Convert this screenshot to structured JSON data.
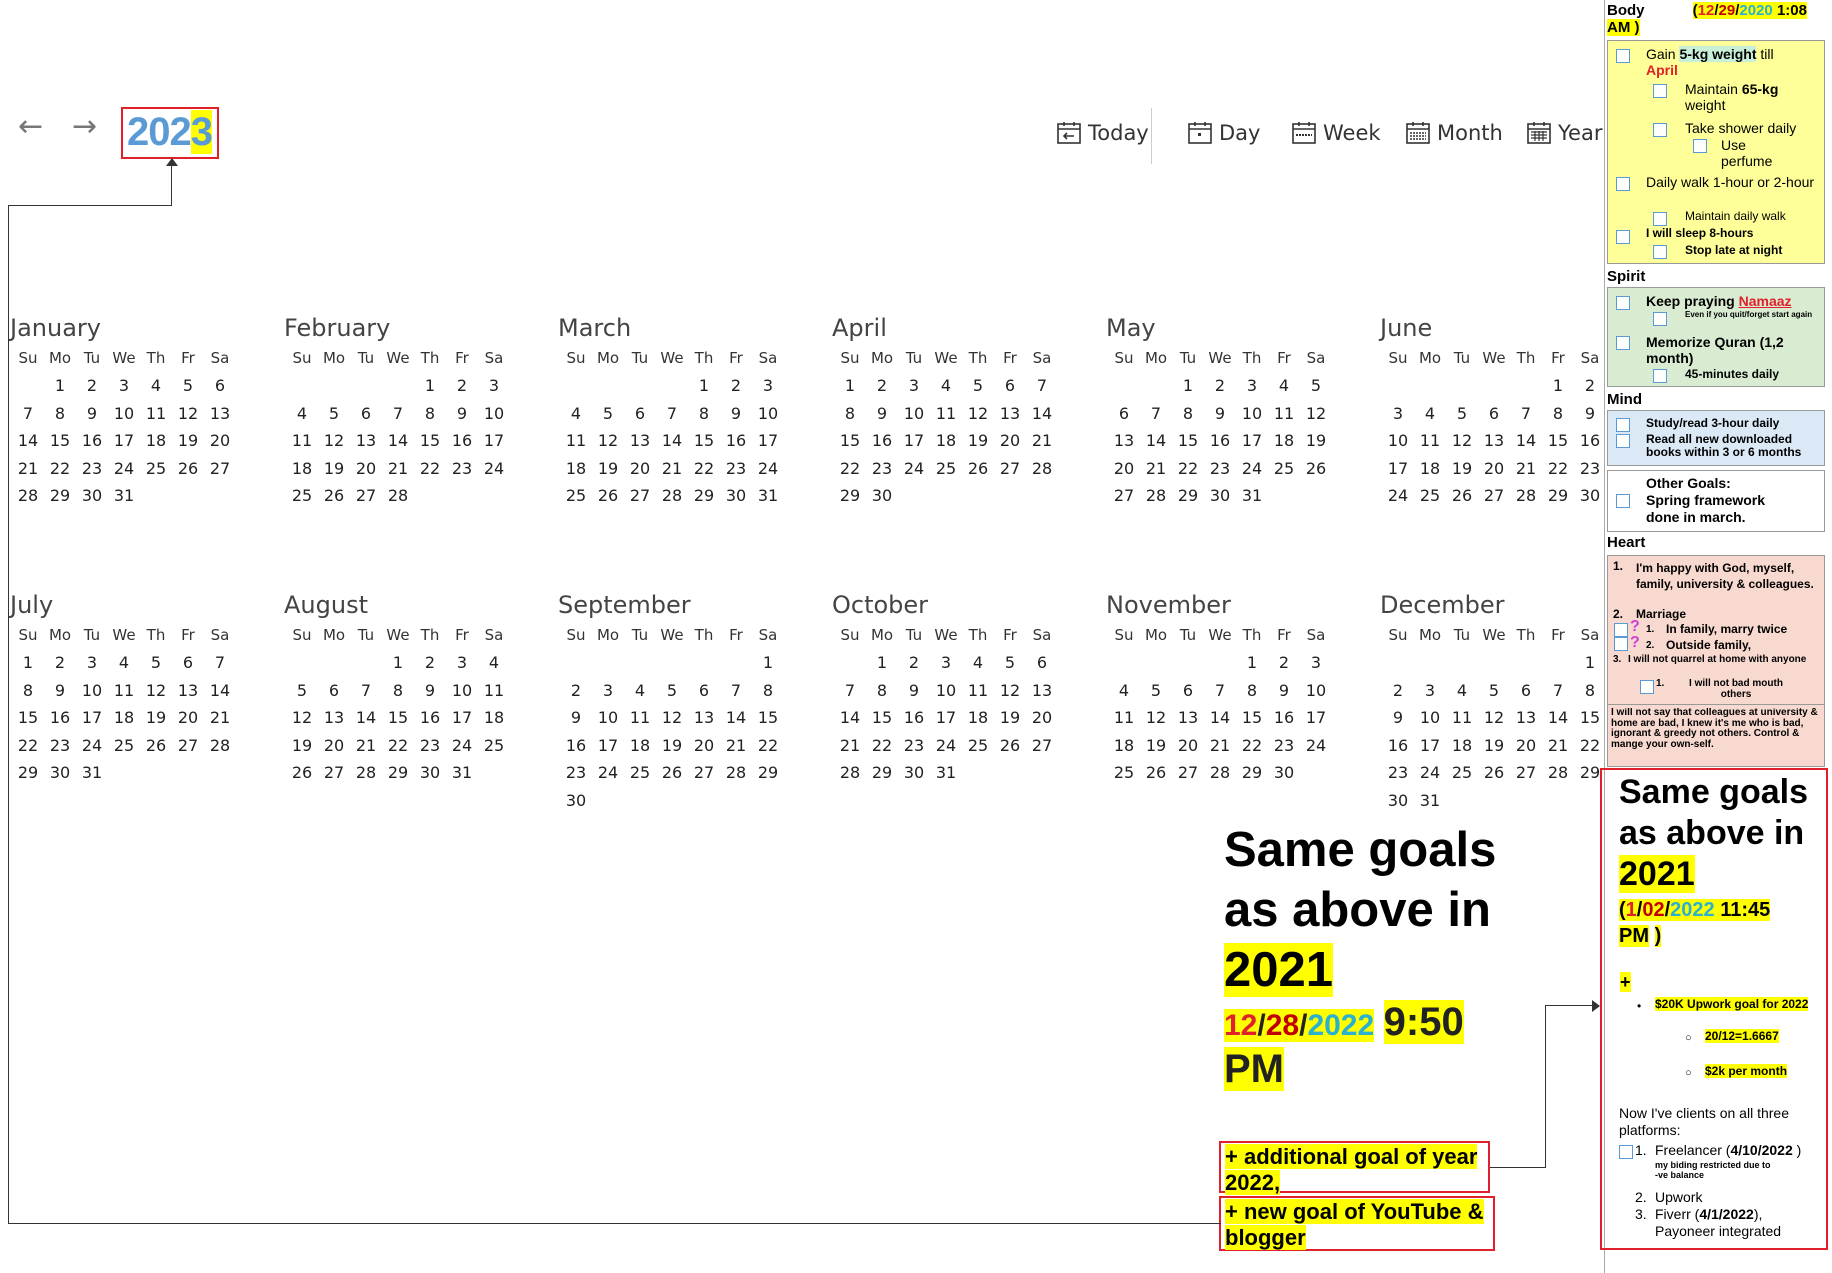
{
  "toolbar": {
    "year_prefix": "202",
    "year_suffix": "3",
    "views": [
      "Today",
      "Day",
      "Week",
      "Month",
      "Year"
    ]
  },
  "calendar": {
    "weekdays": [
      "Su",
      "Mo",
      "Tu",
      "We",
      "Th",
      "Fr",
      "Sa"
    ],
    "months": [
      {
        "name": "January",
        "start": 1,
        "days": 31
      },
      {
        "name": "February",
        "start": 4,
        "days": 28
      },
      {
        "name": "March",
        "start": 4,
        "days": 31
      },
      {
        "name": "April",
        "start": 0,
        "days": 30
      },
      {
        "name": "May",
        "start": 2,
        "days": 31
      },
      {
        "name": "June",
        "start": 5,
        "days": 30
      },
      {
        "name": "July",
        "start": 0,
        "days": 31
      },
      {
        "name": "August",
        "start": 3,
        "days": 31
      },
      {
        "name": "September",
        "start": 6,
        "days": 30
      },
      {
        "name": "October",
        "start": 1,
        "days": 31
      },
      {
        "name": "November",
        "start": 4,
        "days": 30
      },
      {
        "name": "December",
        "start": 6,
        "days": 31
      }
    ]
  },
  "big_note": {
    "line1": "Same goals",
    "line2": "as above in",
    "year": "2021",
    "date_month": "12",
    "date_day": "28",
    "date_year": "2022",
    "time": "9:50",
    "ampm": "PM",
    "additional": "+ additional goal of year 2022,",
    "new_goal": "+ new goal of YouTube & blogger"
  },
  "panel": {
    "body_title": "Body",
    "body_date_open": "(",
    "body_date_m": "12",
    "body_date_d": "29",
    "body_date_y": "2020",
    "body_time": "1:08",
    "body_ampm": "AM )",
    "body": {
      "gain_a": "Gain ",
      "gain_b": "5-kg weight",
      "gain_c": " till",
      "gain_april": "April",
      "maintain_a": "Maintain ",
      "maintain_b": "65-kg",
      "maintain_c": "weight",
      "shower": "Take shower daily",
      "perfume": "Use perfume",
      "walk": "Daily walk 1-hour or 2-hour",
      "walk_sub": "Maintain daily walk",
      "sleep": "I will sleep 8-hours",
      "sleep_sub": "Stop late at night"
    },
    "spirit_title": "Spirit",
    "spirit": {
      "pray_a": "Keep praying ",
      "pray_b": "Namaaz",
      "pray_sub": "Even if you quit/forget start again",
      "quran": "Memorize Quran (1,2 month)",
      "quran_sub": "45-minutes daily"
    },
    "mind_title": "Mind",
    "mind": {
      "study": "Study/read 3-hour daily",
      "books": "Read all new downloaded books within 3 or 6 months"
    },
    "other": {
      "l1": "Other Goals:",
      "l2": "Spring framework",
      "l3": "done in march."
    },
    "heart_title": "Heart",
    "heart": {
      "h1_num": "1.",
      "h1": "I'm happy with God, myself, family, university & colleagues.",
      "h2_num": "2.",
      "h2": "Marriage",
      "h2a_num": "1.",
      "h2a": "In family, marry twice",
      "h2b_num": "2.",
      "h2b": "Outside family,",
      "q1": "?",
      "q2": "?",
      "h3_num": "3.",
      "h3": "I will not quarrel at home with anyone",
      "h3a_num": "1.",
      "h3a": "I will not bad mouth others",
      "note": "I will not say that colleagues at university & home are bad, I knew it's me who is bad, ignorant & greedy not others. Control & mange your own-self."
    },
    "same": {
      "line1": "Same goals",
      "line2": "as above in",
      "year": "2021",
      "date_open": "(",
      "date_m": "1",
      "date_d": "02",
      "date_y": "2022",
      "time": "11:45",
      "ampm": "PM",
      "date_close": ")",
      "plus": "+",
      "upwork_goal": "$20K Upwork goal for 2022",
      "calc": "20/12=1.6667",
      "per_month": "$2k per month",
      "clients": "Now I've clients on all three platforms:",
      "c1_num": "1.",
      "c1_a": "Freelancer (",
      "c1_b": "4/10/2022",
      "c1_c": " )",
      "c1_note": "my biding restricted due to -ve balance",
      "c2_num": "2.",
      "c2": "Upwork",
      "c3_num": "3.",
      "c3_a": "Fiverr (",
      "c3_b": "4/1/2022",
      "c3_c": "),",
      "c3_d": "Payoneer integrated"
    }
  }
}
